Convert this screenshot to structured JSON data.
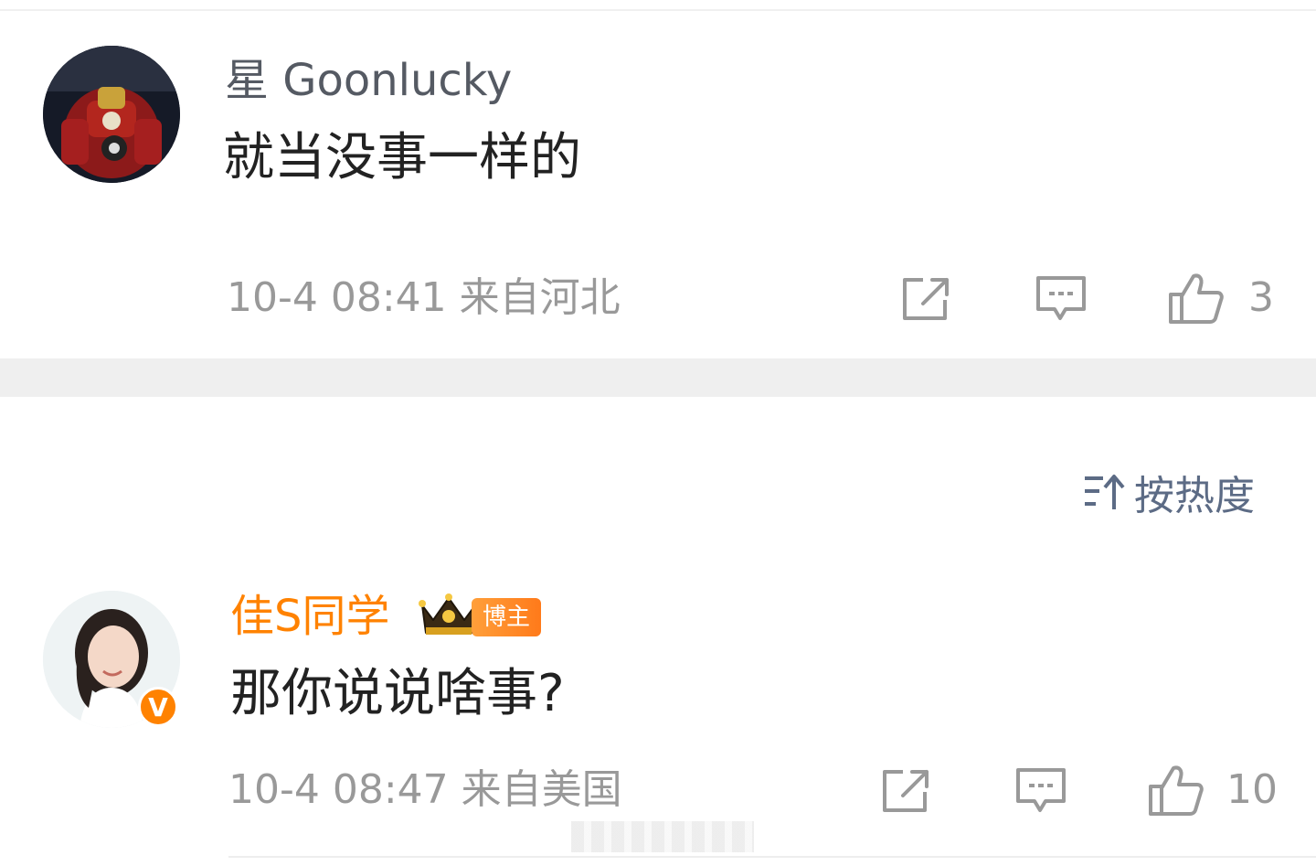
{
  "comments": [
    {
      "username": "星 Goonlucky",
      "text": "就当没事一样的",
      "meta": "10-4 08:41  来自河北",
      "likes": "3",
      "avatar_icon": "armor-robot-avatar"
    },
    {
      "username": "佳S同学",
      "text": "那你说说啥事?",
      "meta": "10-4 08:47  来自美国",
      "likes": "10",
      "avatar_icon": "woman-portrait-avatar",
      "blogger_label": "博主",
      "verified_badge": "V"
    }
  ],
  "sort": {
    "label": "按热度",
    "icon": "sort-icon"
  },
  "colors": {
    "accent_orange": "#ff8200",
    "sort_blue": "#5c6b85",
    "meta_gray": "#999999",
    "divider": "#efefef"
  }
}
